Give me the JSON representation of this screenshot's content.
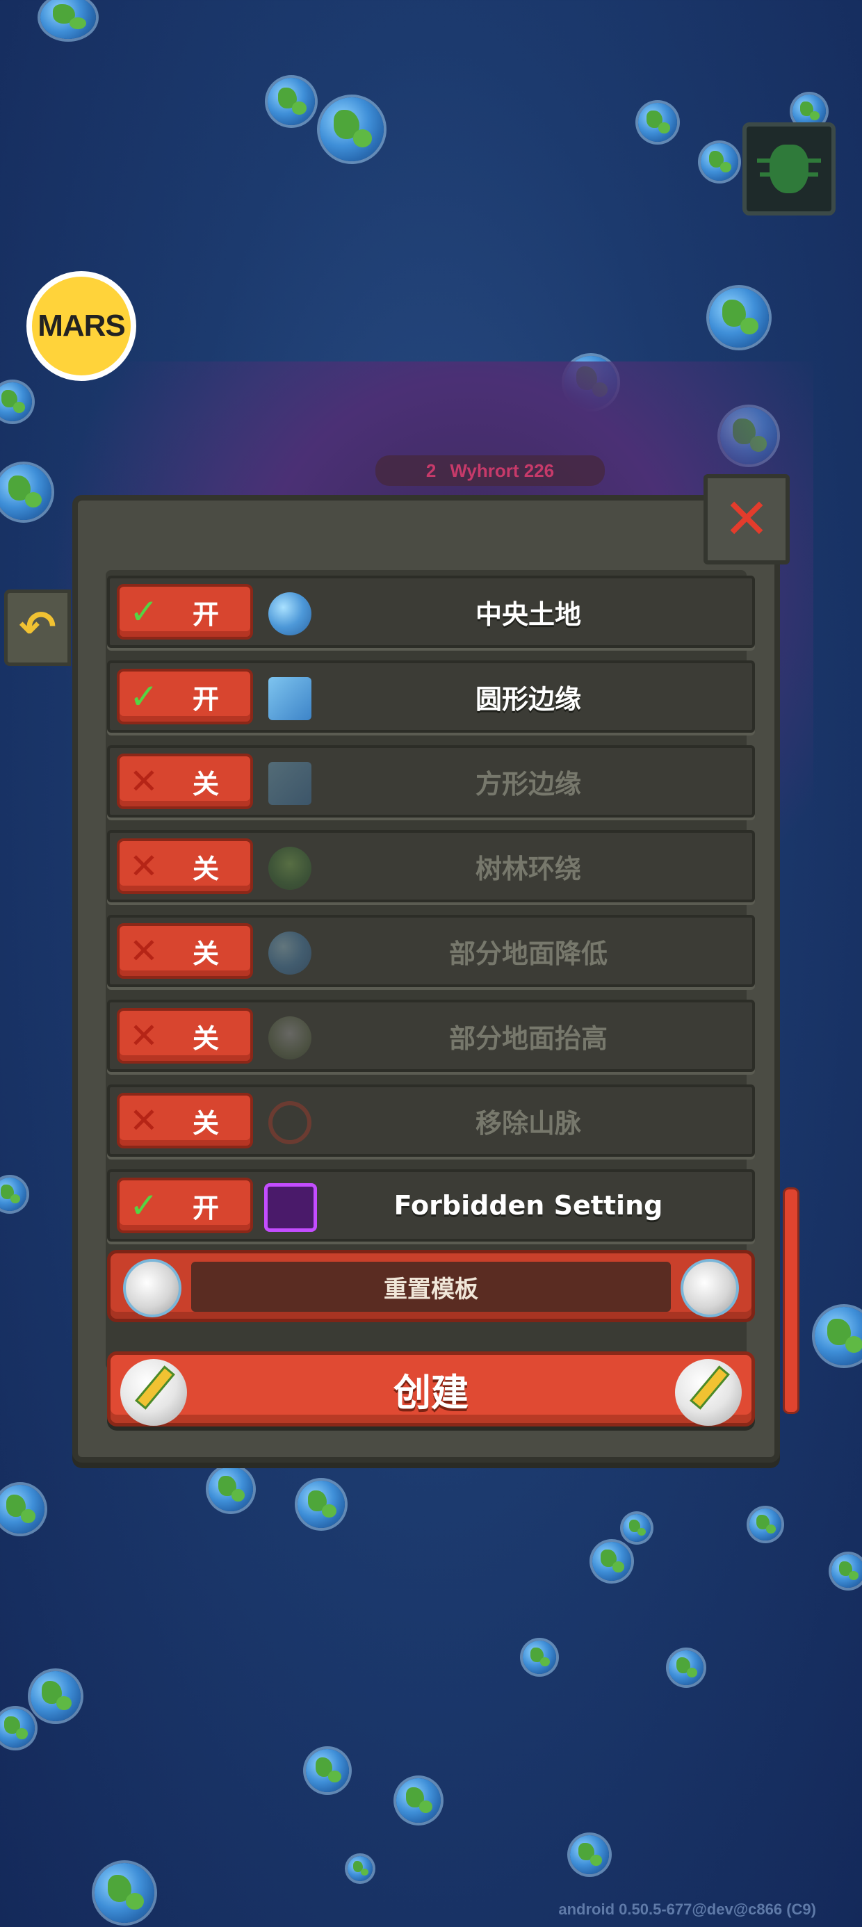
{
  "badge": {
    "label": "MARS"
  },
  "world_tag": {
    "number": "2",
    "name": "Wyhrort 226"
  },
  "options": [
    {
      "state": "开",
      "on": true,
      "name": "中央土地",
      "icon": "central-land-icon"
    },
    {
      "state": "开",
      "on": true,
      "name": "圆形边缘",
      "icon": "round-edges-icon"
    },
    {
      "state": "关",
      "on": false,
      "name": "方形边缘",
      "icon": "square-edges-icon"
    },
    {
      "state": "关",
      "on": false,
      "name": "树林环绕",
      "icon": "forest-ring-icon"
    },
    {
      "state": "关",
      "on": false,
      "name": "部分地面降低",
      "icon": "lower-ground-icon"
    },
    {
      "state": "关",
      "on": false,
      "name": "部分地面抬高",
      "icon": "raise-ground-icon"
    },
    {
      "state": "关",
      "on": false,
      "name": "移除山脉",
      "icon": "remove-mountains-icon"
    },
    {
      "state": "开",
      "on": true,
      "name": "Forbidden Setting",
      "icon": "forbidden-setting-icon"
    }
  ],
  "reset_label": "重置模板",
  "create_label": "创建",
  "version": "android 0.50.5-677@dev@c866 (C9)",
  "colors": {
    "toggle_red": "#d8452f",
    "check_green": "#55d444",
    "panel": "#4b4c44"
  }
}
